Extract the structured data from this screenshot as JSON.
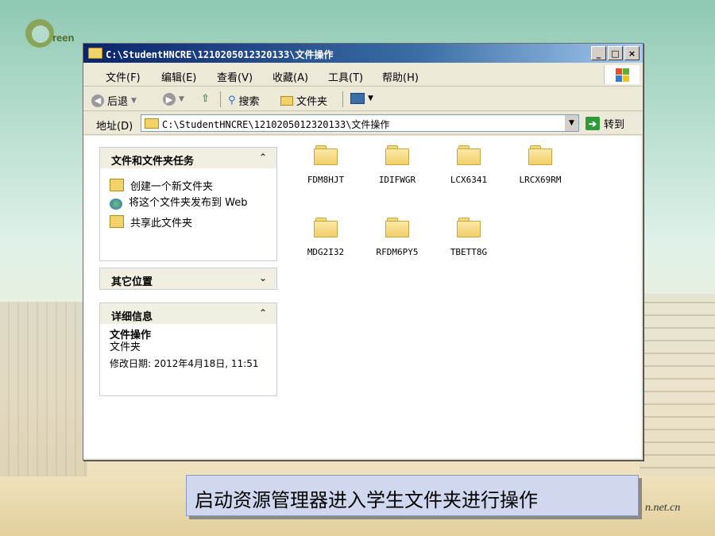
{
  "background": {
    "logo_text": "reen",
    "url_tail": "n.net.cn"
  },
  "window": {
    "title": "C:\\StudentHNCRE\\1210205012320133\\文件操作",
    "buttons": {
      "minimize": "_",
      "maximize": "□",
      "close": "×"
    }
  },
  "menu": [
    "文件(F)",
    "编辑(E)",
    "查看(V)",
    "收藏(A)",
    "工具(T)",
    "帮助(H)"
  ],
  "toolbar": {
    "back": "后退",
    "search": "搜索",
    "folders": "文件夹"
  },
  "address": {
    "label": "地址(D)",
    "value": "C:\\StudentHNCRE\\1210205012320133\\文件操作",
    "go": "转到"
  },
  "panels": {
    "tasks": {
      "title": "文件和文件夹任务",
      "items": [
        "创建一个新文件夹",
        "将这个文件夹发布到 Web",
        "共享此文件夹"
      ]
    },
    "places": {
      "title": "其它位置"
    },
    "details": {
      "title": "详细信息",
      "name": "文件操作",
      "type": "文件夹",
      "modified": "修改日期: 2012年4月18日, 11:51"
    }
  },
  "folders": [
    "FDM8HJT",
    "IDIFWGR",
    "LCX6341",
    "LRCX69RM",
    "MDG2I32",
    "RFDM6PY5",
    "TBETT8G"
  ],
  "caption": "启动资源管理器进入学生文件夹进行操作",
  "colors": {
    "titlebar": "#0a246a",
    "panel_header": "#f1efe2",
    "caption_bg": "#cfd8ee",
    "folder": "#f2cf6a"
  }
}
